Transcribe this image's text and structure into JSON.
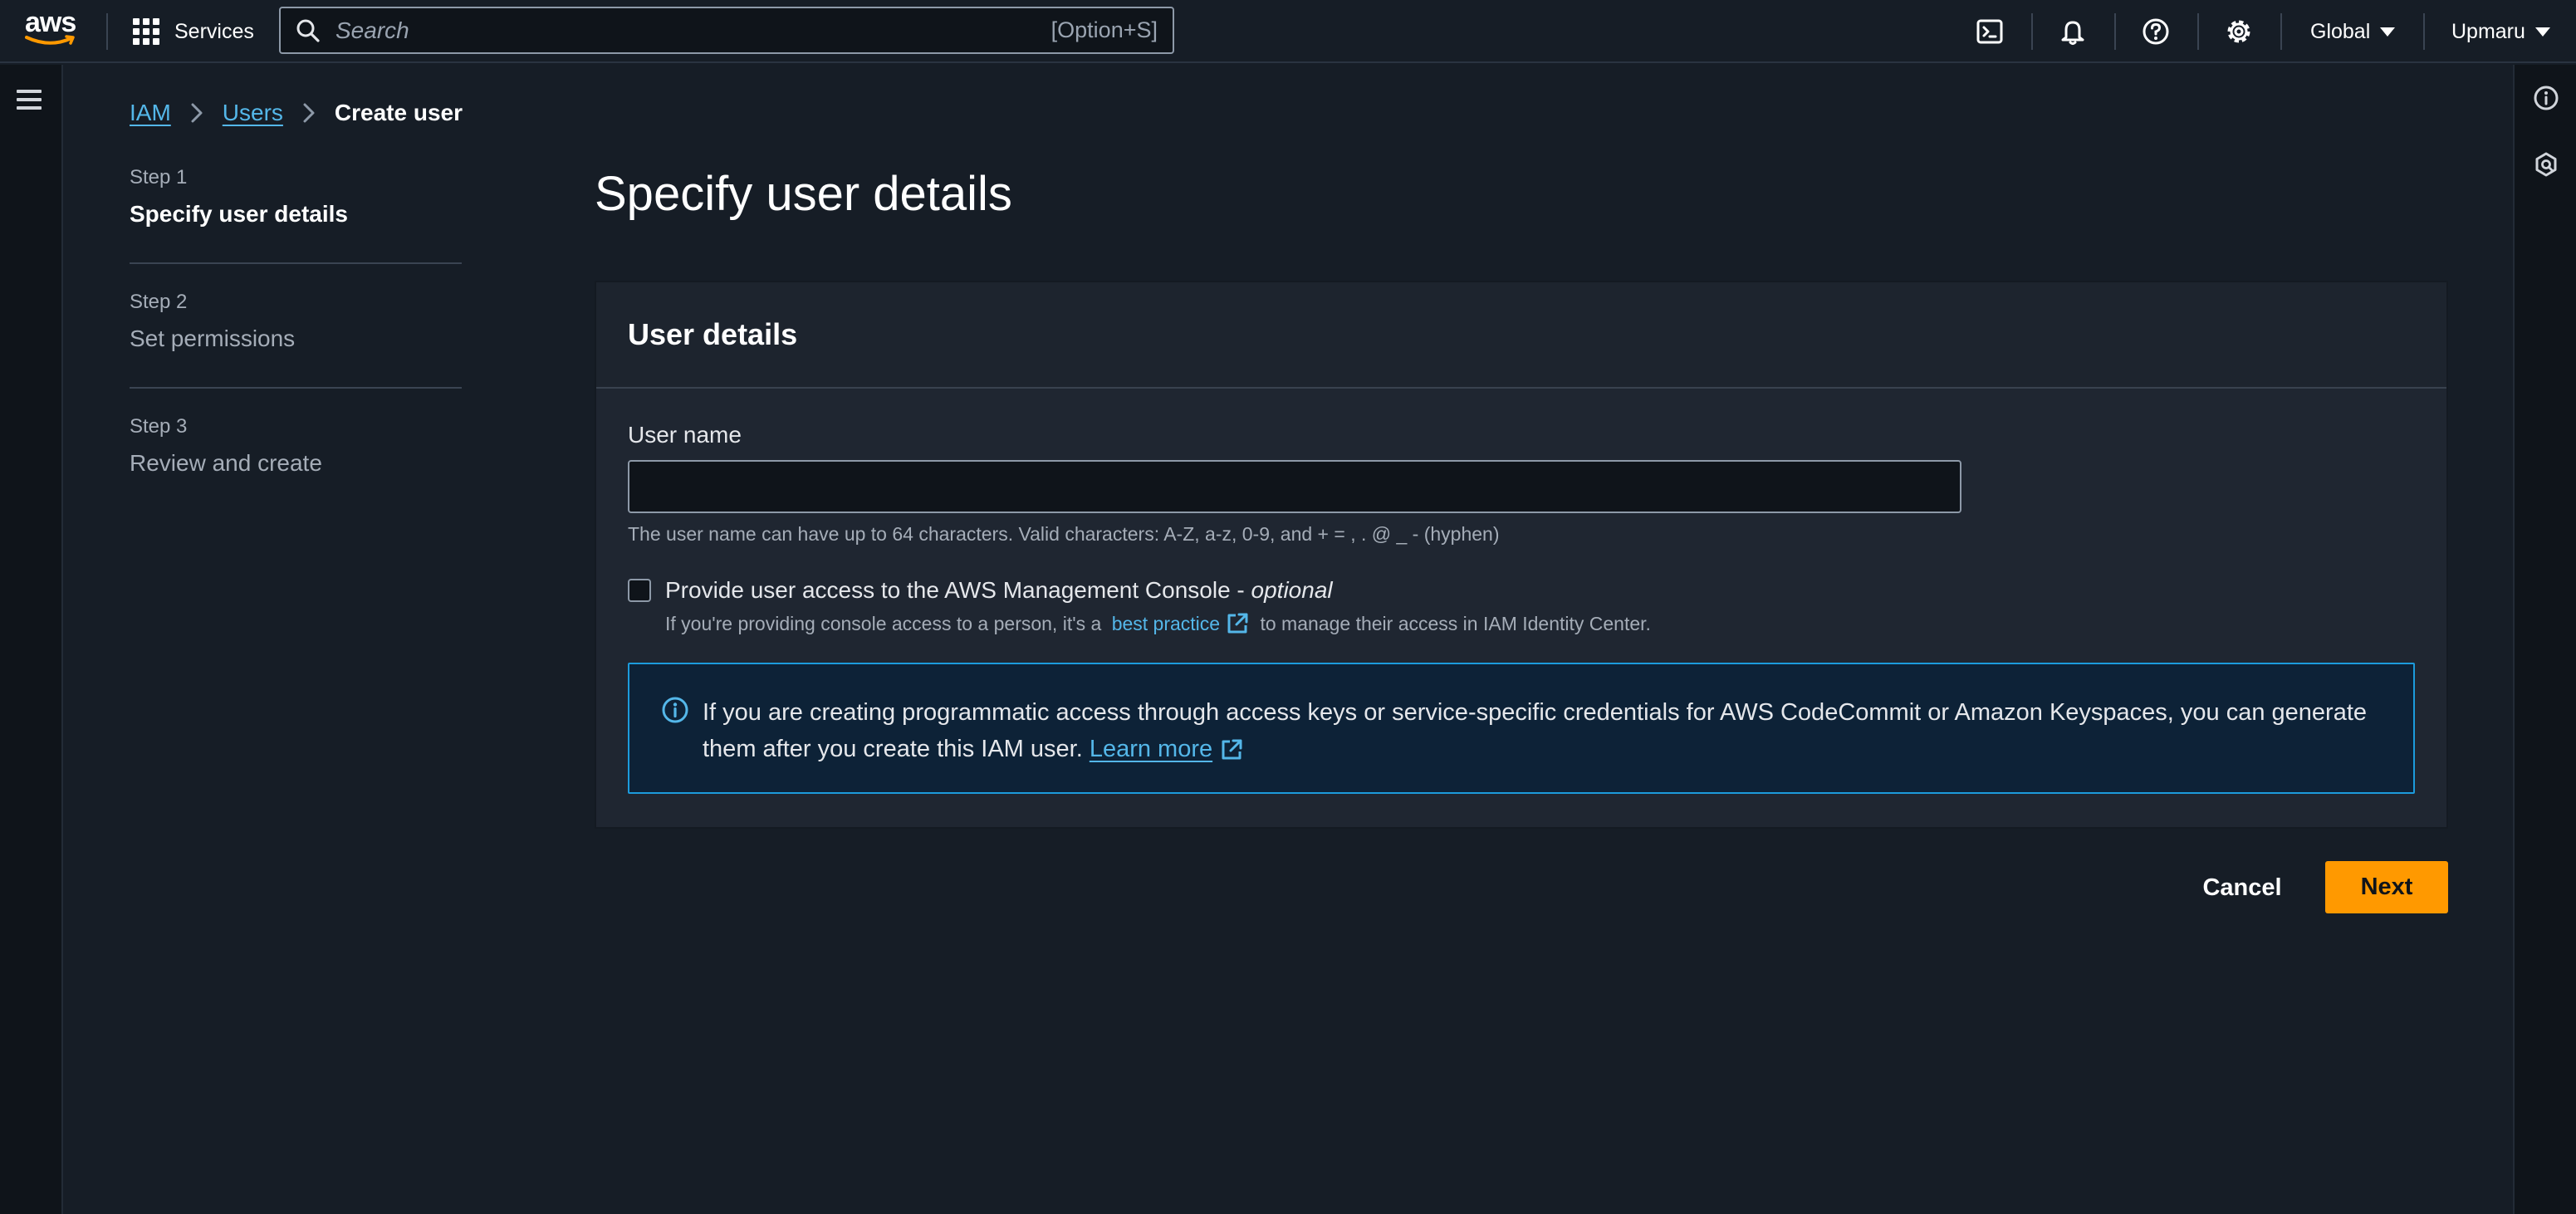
{
  "topnav": {
    "logo_text": "aws",
    "services_label": "Services",
    "search_placeholder": "Search",
    "search_shortcut": "[Option+S]",
    "region_label": "Global",
    "account_label": "Upmaru",
    "icons": [
      "cloudshell-icon",
      "notifications-icon",
      "help-icon",
      "settings-icon"
    ]
  },
  "breadcrumb": {
    "items": [
      "IAM",
      "Users"
    ],
    "current": "Create user"
  },
  "steps": [
    {
      "number": "Step 1",
      "name": "Specify user details",
      "active": true
    },
    {
      "number": "Step 2",
      "name": "Set permissions",
      "active": false
    },
    {
      "number": "Step 3",
      "name": "Review and create",
      "active": false
    }
  ],
  "main": {
    "title": "Specify user details",
    "panel_title": "User details",
    "username_label": "User name",
    "username_value": "",
    "username_hint": "The user name can have up to 64 characters. Valid characters: A-Z, a-z, 0-9, and + = , . @ _ - (hyphen)",
    "console_access_label": "Provide user access to the AWS Management Console - ",
    "console_access_optional": "optional",
    "console_access_checked": false,
    "console_sub_before": "If you're providing console access to a person, it's a ",
    "console_sub_link": "best practice",
    "console_sub_after": " to manage their access in IAM Identity Center.",
    "info_text": "If you are creating programmatic access through access keys or service-specific credentials for AWS CodeCommit or Amazon Keyspaces, you can generate them after you create this IAM user. ",
    "info_link": "Learn more"
  },
  "footer": {
    "cancel_label": "Cancel",
    "next_label": "Next"
  },
  "colors": {
    "background": "#161d26",
    "panel": "#1f2631",
    "link": "#54b7e9",
    "primary_button": "#ff9900",
    "info_border": "#1c9bdc",
    "info_background": "#0d2237"
  }
}
